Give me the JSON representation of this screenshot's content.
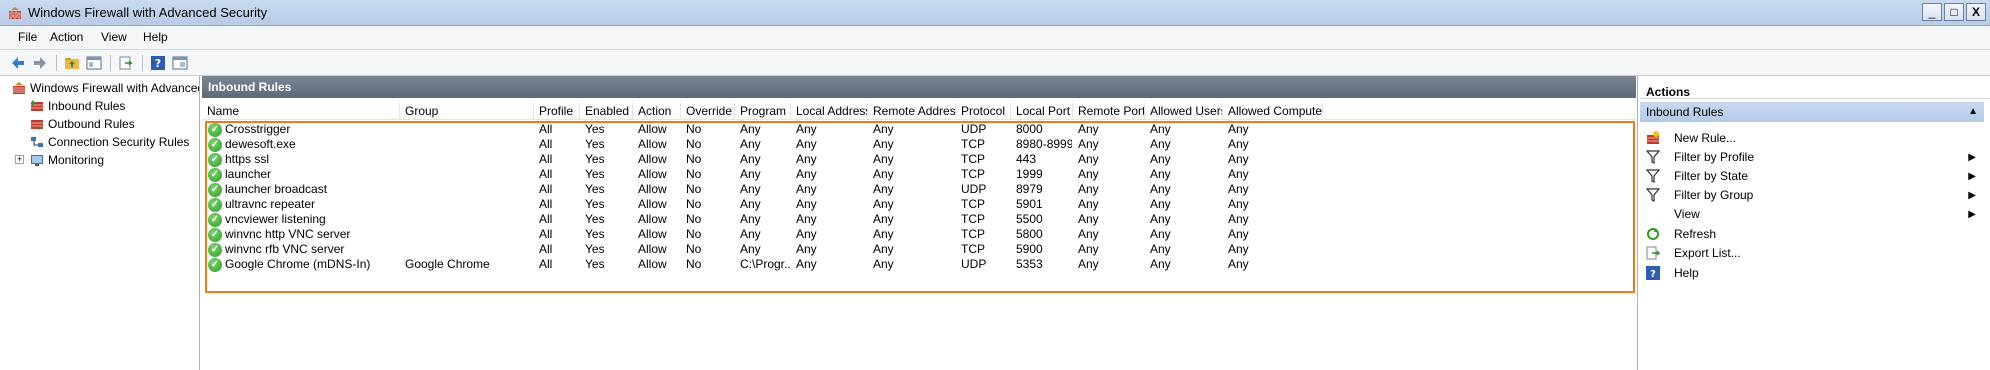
{
  "window": {
    "title": "Windows Firewall with Advanced Security",
    "buttons": {
      "minimize": "_",
      "maximize": "□",
      "close": "X"
    }
  },
  "menu": [
    "File",
    "Action",
    "View",
    "Help"
  ],
  "toolbar": [
    "back-icon",
    "forward-icon",
    "up-folder-icon",
    "show-hide-tree-icon",
    "export-icon",
    "help-icon",
    "properties-icon"
  ],
  "tree": {
    "root": "Windows Firewall with Advanced Security",
    "items": [
      "Inbound Rules",
      "Outbound Rules",
      "Connection Security Rules",
      "Monitoring"
    ],
    "expander": "+"
  },
  "center": {
    "title": "Inbound Rules",
    "columns": [
      "Name",
      "Group",
      "Profile",
      "Enabled",
      "Action",
      "Override",
      "Program",
      "Local Address",
      "Remote Address",
      "Protocol",
      "Local Port",
      "Remote Port",
      "Allowed Users",
      "Allowed Computers"
    ],
    "rows": [
      [
        "Crosstrigger",
        "",
        "All",
        "Yes",
        "Allow",
        "No",
        "Any",
        "Any",
        "Any",
        "UDP",
        "8000",
        "Any",
        "Any",
        "Any"
      ],
      [
        "dewesoft.exe",
        "",
        "All",
        "Yes",
        "Allow",
        "No",
        "Any",
        "Any",
        "Any",
        "TCP",
        "8980-8999",
        "Any",
        "Any",
        "Any"
      ],
      [
        "https ssl",
        "",
        "All",
        "Yes",
        "Allow",
        "No",
        "Any",
        "Any",
        "Any",
        "TCP",
        "443",
        "Any",
        "Any",
        "Any"
      ],
      [
        "launcher",
        "",
        "All",
        "Yes",
        "Allow",
        "No",
        "Any",
        "Any",
        "Any",
        "TCP",
        "1999",
        "Any",
        "Any",
        "Any"
      ],
      [
        "launcher broadcast",
        "",
        "All",
        "Yes",
        "Allow",
        "No",
        "Any",
        "Any",
        "Any",
        "UDP",
        "8979",
        "Any",
        "Any",
        "Any"
      ],
      [
        "ultravnc repeater",
        "",
        "All",
        "Yes",
        "Allow",
        "No",
        "Any",
        "Any",
        "Any",
        "TCP",
        "5901",
        "Any",
        "Any",
        "Any"
      ],
      [
        "vncviewer listening",
        "",
        "All",
        "Yes",
        "Allow",
        "No",
        "Any",
        "Any",
        "Any",
        "TCP",
        "5500",
        "Any",
        "Any",
        "Any"
      ],
      [
        "winvnc http VNC server",
        "",
        "All",
        "Yes",
        "Allow",
        "No",
        "Any",
        "Any",
        "Any",
        "TCP",
        "5800",
        "Any",
        "Any",
        "Any"
      ],
      [
        "winvnc rfb VNC server",
        "",
        "All",
        "Yes",
        "Allow",
        "No",
        "Any",
        "Any",
        "Any",
        "TCP",
        "5900",
        "Any",
        "Any",
        "Any"
      ],
      [
        "Google Chrome (mDNS-In)",
        "Google Chrome",
        "All",
        "Yes",
        "Allow",
        "No",
        "C:\\Progr...",
        "Any",
        "Any",
        "UDP",
        "5353",
        "Any",
        "Any",
        "Any"
      ]
    ]
  },
  "actions": {
    "title": "Actions",
    "section": "Inbound Rules",
    "items": [
      {
        "label": "New Rule...",
        "icon": "new-rule-icon",
        "submenu": false
      },
      {
        "label": "Filter by Profile",
        "icon": "filter-icon",
        "submenu": true
      },
      {
        "label": "Filter by State",
        "icon": "filter-icon",
        "submenu": true
      },
      {
        "label": "Filter by Group",
        "icon": "filter-icon",
        "submenu": true
      },
      {
        "label": "View",
        "icon": "",
        "submenu": true
      },
      {
        "label": "Refresh",
        "icon": "refresh-icon",
        "submenu": false
      },
      {
        "label": "Export List...",
        "icon": "export-list-icon",
        "submenu": false
      },
      {
        "label": "Help",
        "icon": "help-icon",
        "submenu": false
      }
    ]
  },
  "colors": {
    "highlight": "#f07a1c",
    "check": "#2f9a2a",
    "pane_header": "#6a7482"
  }
}
